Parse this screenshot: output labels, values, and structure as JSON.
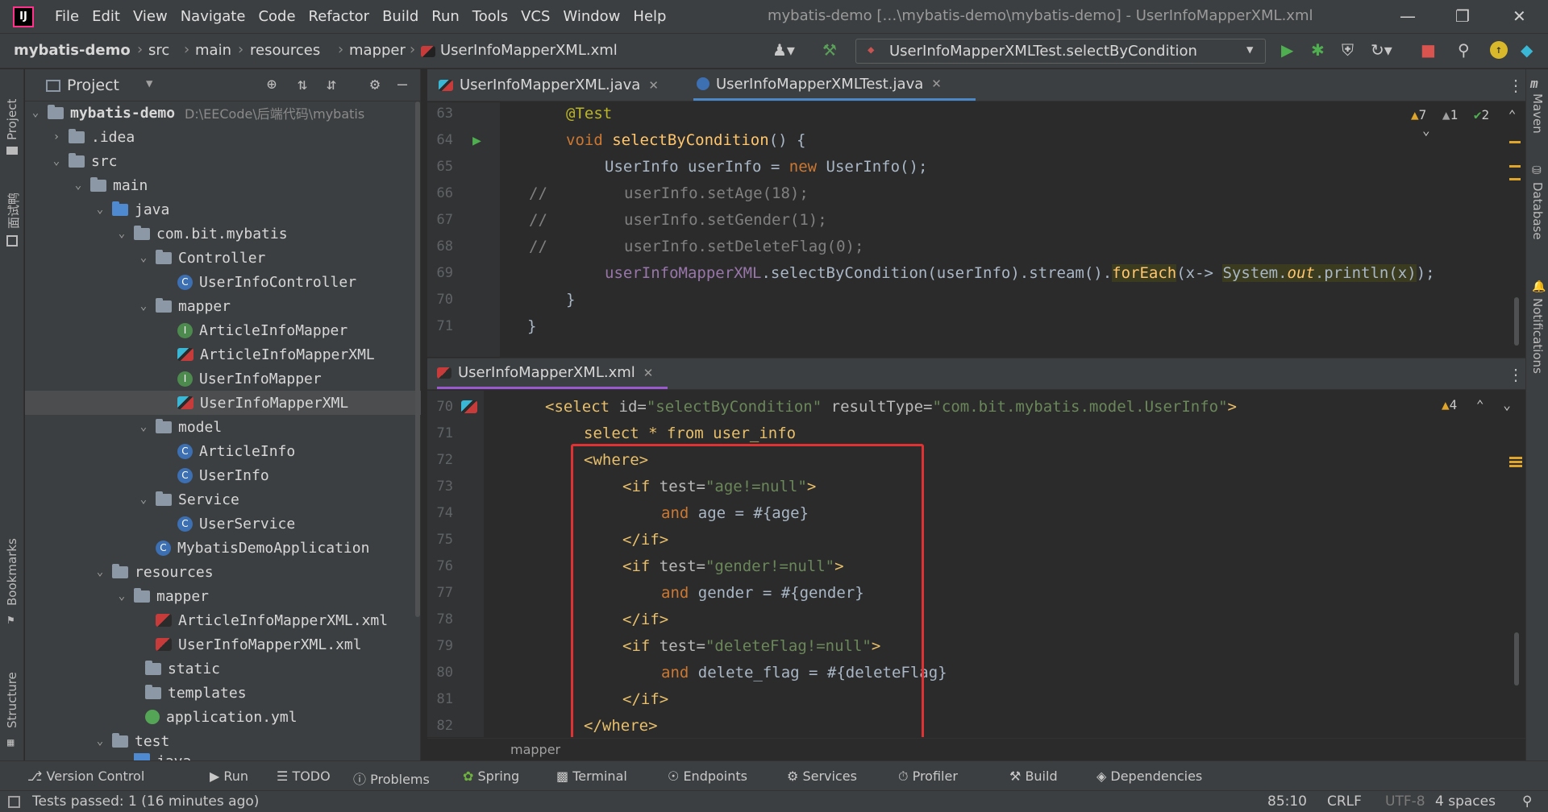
{
  "menu": [
    "File",
    "Edit",
    "View",
    "Navigate",
    "Code",
    "Refactor",
    "Build",
    "Run",
    "Tools",
    "VCS",
    "Window",
    "Help"
  ],
  "window_title": "mybatis-demo […\\mybatis-demo\\mybatis-demo] - UserInfoMapperXML.xml",
  "breadcrumb": [
    "mybatis-demo",
    "src",
    "main",
    "resources",
    "mapper",
    "UserInfoMapperXML.xml"
  ],
  "run_config": "UserInfoMapperXMLTest.selectByCondition",
  "left_stripe": {
    "project": "Project",
    "second": "面试鸭",
    "bookmarks": "Bookmarks",
    "structure": "Structure"
  },
  "right_stripe": {
    "maven": "Maven",
    "database": "Database",
    "notifications": "Notifications"
  },
  "project_panel": {
    "title": "Project",
    "root_name": "mybatis-demo",
    "root_path": "D:\\EECode\\后端代码\\mybatis",
    "tree": [
      {
        "label": ".idea"
      },
      {
        "label": "src"
      },
      {
        "label": "main"
      },
      {
        "label": "java"
      },
      {
        "label": "com.bit.mybatis"
      },
      {
        "label": "Controller"
      },
      {
        "label": "UserInfoController"
      },
      {
        "label": "mapper"
      },
      {
        "label": "ArticleInfoMapper"
      },
      {
        "label": "ArticleInfoMapperXML"
      },
      {
        "label": "UserInfoMapper"
      },
      {
        "label": "UserInfoMapperXML"
      },
      {
        "label": "model"
      },
      {
        "label": "ArticleInfo"
      },
      {
        "label": "UserInfo"
      },
      {
        "label": "Service"
      },
      {
        "label": "UserService"
      },
      {
        "label": "MybatisDemoApplication"
      },
      {
        "label": "resources"
      },
      {
        "label": "mapper"
      },
      {
        "label": "ArticleInfoMapperXML.xml"
      },
      {
        "label": "UserInfoMapperXML.xml"
      },
      {
        "label": "static"
      },
      {
        "label": "templates"
      },
      {
        "label": "application.yml"
      },
      {
        "label": "test"
      },
      {
        "label": "java"
      }
    ]
  },
  "top_editor": {
    "tabs": [
      "UserInfoMapperXML.java",
      "UserInfoMapperXMLTest.java"
    ],
    "inspections": {
      "warnings": "7",
      "weak_warnings": "1",
      "ok": "2"
    },
    "line_numbers": [
      "63",
      "64",
      "65",
      "66",
      "67",
      "68",
      "69",
      "70",
      "71"
    ],
    "code": {
      "l63": "@Test",
      "l64_kw": "void",
      "l64_fn": "selectByCondition",
      "l64_rest": "() {",
      "l65_a": "UserInfo userInfo = ",
      "l65_kw": "new",
      "l65_b": " UserInfo();",
      "l66_c": "//",
      "l66": "userInfo.setAge(18);",
      "l67_c": "//",
      "l67": "userInfo.setGender(1);",
      "l68_c": "//",
      "l68": "userInfo.setDeleteFlag(0);",
      "l69_field": "userInfoMapperXML",
      "l69_a": ".selectByCondition(userInfo).stream().",
      "l69_fe": "forEach",
      "l69_b": "(x-> ",
      "l69_sys": "System.",
      "l69_out": "out",
      "l69_pr": ".println(x)",
      "l69_end": ");",
      "l70": "}",
      "l71": "}"
    }
  },
  "bottom_editor": {
    "tab": "UserInfoMapperXML.xml",
    "inspections": {
      "warnings": "4"
    },
    "line_numbers": [
      "70",
      "71",
      "72",
      "73",
      "74",
      "75",
      "76",
      "77",
      "78",
      "79",
      "80",
      "81",
      "82"
    ],
    "code": {
      "l70_tag": "<select ",
      "l70_a1": "id=",
      "l70_v1": "\"selectByCondition\"",
      "l70_a2": " resultType=",
      "l70_v2": "\"com.bit.mybatis.model.UserInfo\"",
      "l70_end": ">",
      "l71_sql": "select * from user_info",
      "l72": "<where>",
      "l73_tag": "<if ",
      "l73_a": "test=",
      "l73_v": "\"age!=null\"",
      "l73_end": ">",
      "l74_kw": "and",
      "l74": " age = #{age}",
      "l75": "</if>",
      "l76_tag": "<if ",
      "l76_a": "test=",
      "l76_v": "\"gender!=null\"",
      "l76_end": ">",
      "l77_kw": "and",
      "l77": " gender = #{gender}",
      "l78": "</if>",
      "l79_tag": "<if ",
      "l79_a": "test=",
      "l79_v": "\"deleteFlag!=null\"",
      "l79_end": ">",
      "l80_kw": "and",
      "l80": " delete_flag = #{deleteFlag}",
      "l81": "</if>",
      "l82": "</where>"
    },
    "breadcrumb": "mapper",
    "highlight_color": "#e03232"
  },
  "tool_tabs": [
    "Version Control",
    "Run",
    "TODO",
    "Problems",
    "Spring",
    "Terminal",
    "Endpoints",
    "Services",
    "Profiler",
    "Build",
    "Dependencies"
  ],
  "status": {
    "message": "Tests passed: 1 (16 minutes ago)",
    "position": "85:10",
    "line_sep": "CRLF",
    "encoding": "UTF-8",
    "indent": "4 spaces"
  }
}
